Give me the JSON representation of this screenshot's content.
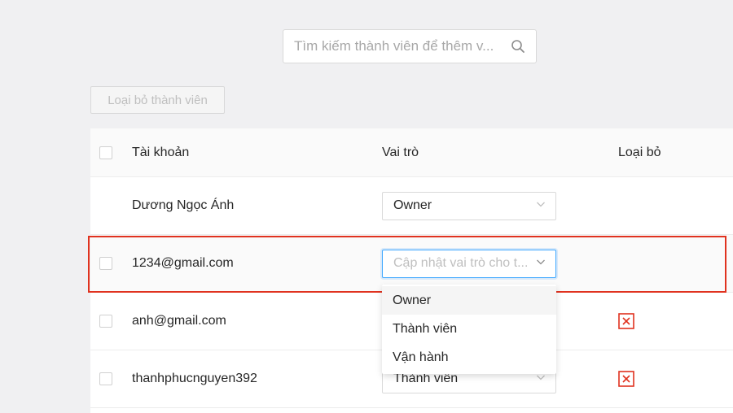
{
  "search": {
    "placeholder": "Tìm kiếm thành viên để thêm v..."
  },
  "toolbar": {
    "remove_members_label": "Loại bỏ thành viên"
  },
  "table": {
    "headers": {
      "account": "Tài khoản",
      "role": "Vai trò",
      "remove": "Loại bỏ"
    },
    "rows": [
      {
        "account": "Dương Ngọc Ánh",
        "role": "Owner",
        "has_checkbox": false,
        "removable": false
      },
      {
        "account": "1234@gmail.com",
        "role_placeholder": "Cập nhật vai trò cho t...",
        "has_checkbox": true,
        "removable": false
      },
      {
        "account": "anh@gmail.com",
        "role": "",
        "has_checkbox": true,
        "removable": true
      },
      {
        "account": "thanhphucnguyen392",
        "role": "Thành viên",
        "has_checkbox": true,
        "removable": true
      }
    ]
  },
  "dropdown": {
    "options": [
      "Owner",
      "Thành viên",
      "Vận hành"
    ]
  },
  "colors": {
    "highlight": "#e0321f",
    "remove_icon": "#e0321f",
    "focus_border": "#40a9ff"
  },
  "icons": {
    "search": "search-icon",
    "chevron": "chevron-down-icon",
    "remove": "close-box-icon"
  }
}
